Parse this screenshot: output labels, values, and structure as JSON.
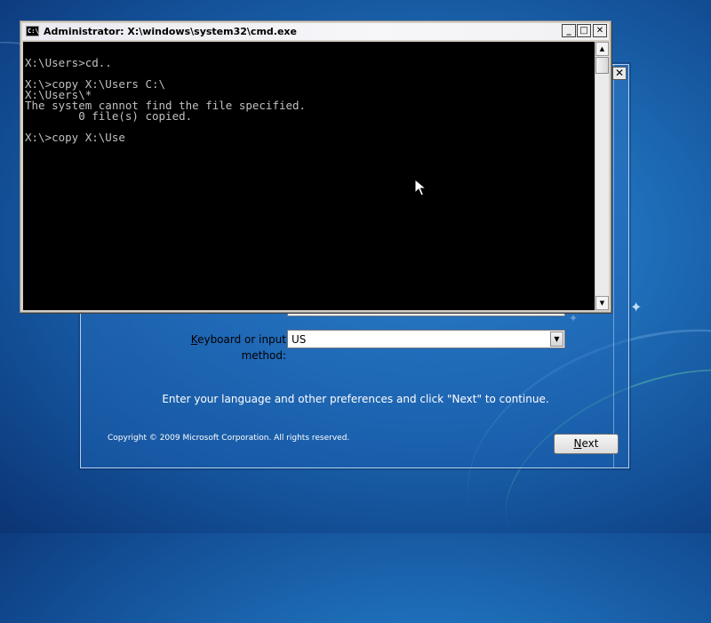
{
  "cmd": {
    "title": "Administrator: X:\\windows\\system32\\cmd.exe",
    "icon_text": "C:\\",
    "buttons": {
      "minimize": "_",
      "maximize": "□",
      "close": "✕"
    },
    "console_lines": [
      "",
      "X:\\Users>cd..",
      "",
      "X:\\>copy X:\\Users C:\\",
      "X:\\Users\\*",
      "The system cannot find the file specified.",
      "        0 file(s) copied.",
      "",
      "X:\\>copy X:\\Use"
    ]
  },
  "setup": {
    "close": "✕",
    "keyboard": {
      "label": "Keyboard or input method:",
      "accesskey": "K",
      "value": "US"
    },
    "instructions": "Enter your language and other preferences and click \"Next\" to continue.",
    "copyright": "Copyright © 2009 Microsoft Corporation. All rights reserved.",
    "next": "Next"
  },
  "icons": {
    "setup_close": "close-icon",
    "dropdown": "chevron-down-icon",
    "scroll_up": "triangle-up-icon",
    "scroll_down": "triangle-down-icon",
    "cursor": "mouse-pointer-icon"
  },
  "colors": {
    "console_bg": "#000000",
    "console_text": "#c0c0c0",
    "desktop": "#1f6fba"
  }
}
